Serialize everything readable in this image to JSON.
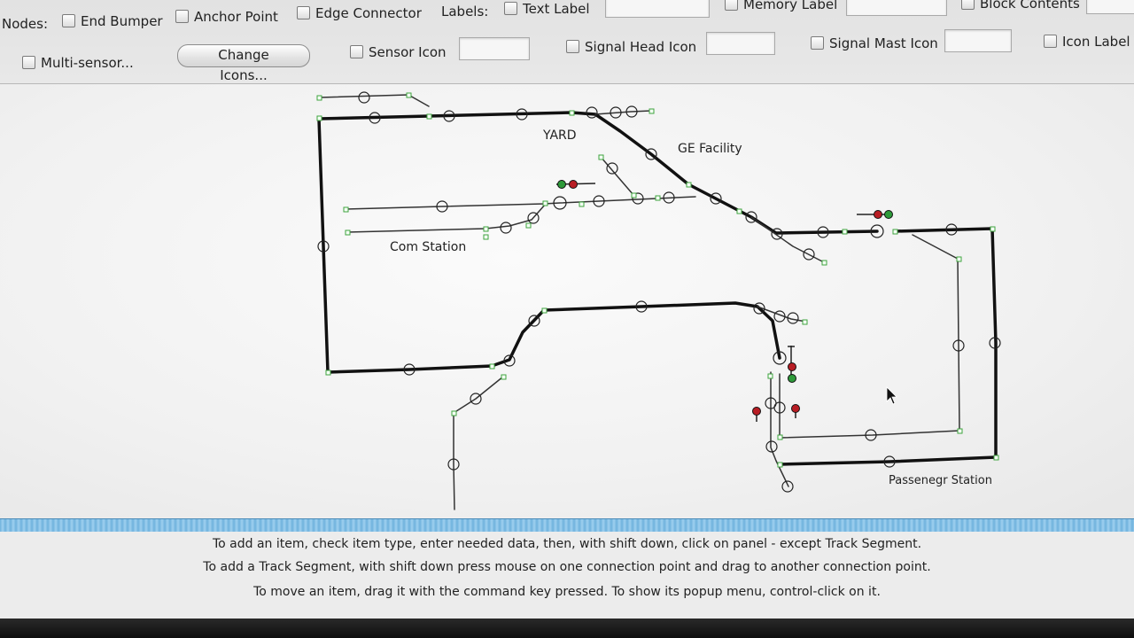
{
  "toolbar": {
    "nodes_label": "Nodes:",
    "end_bumper": "End Bumper",
    "anchor_point": "Anchor Point",
    "edge_connector": "Edge Connector",
    "labels_label": "Labels:",
    "text_label": "Text Label",
    "memory_label": "Memory Label",
    "block_contents": "Block Contents",
    "multi_sensor": "Multi-sensor...",
    "change_icons": "Change Icons...",
    "sensor_icon": "Sensor Icon",
    "signal_head_icon": "Signal Head Icon",
    "signal_mast_icon": "Signal Mast Icon",
    "icon_label": "Icon Label"
  },
  "panel": {
    "labels": {
      "yard": "YARD",
      "ge_facility": "GE Facility",
      "com_station": "Com Station",
      "passenger_station": "Passenegr Station"
    }
  },
  "help": {
    "line1": "To add an item, check item type, enter needed data, then, with shift down, click on panel - except Track Segment.",
    "line2": "To add a Track Segment, with shift down press mouse on one connection point and drag to another connection point.",
    "line3": "To move an item, drag it with the command key pressed. To show its popup menu, control-click on it."
  },
  "colors": {
    "mainline": "#111111",
    "siding": "#333333",
    "anchor": "#3fa33f",
    "signal_red": "#b81d24",
    "signal_green": "#2e9a3a",
    "divider": "#6fb2dd"
  }
}
